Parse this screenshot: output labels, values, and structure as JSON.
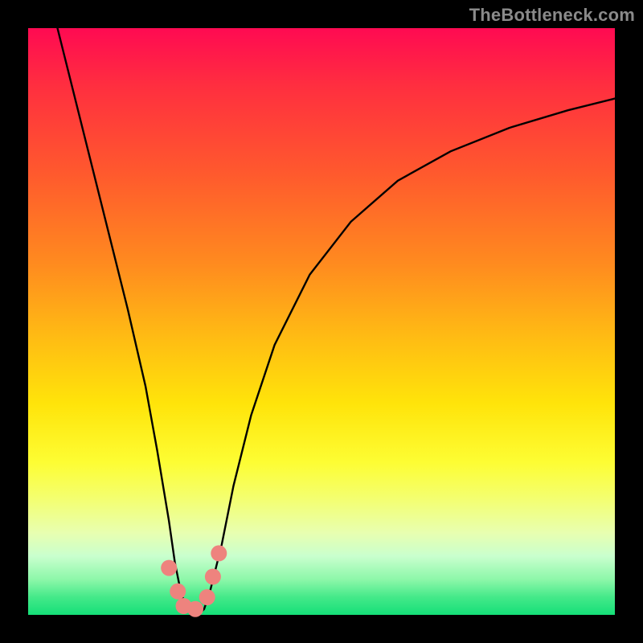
{
  "watermark": "TheBottleneck.com",
  "chart_data": {
    "type": "line",
    "title": "",
    "xlabel": "",
    "ylabel": "",
    "xlim": [
      0,
      100
    ],
    "ylim": [
      0,
      100
    ],
    "series": [
      {
        "name": "curve",
        "x": [
          5,
          8,
          11,
          14,
          17,
          20,
          22,
          24,
          25,
          26,
          27,
          28,
          29,
          30,
          31,
          33,
          35,
          38,
          42,
          48,
          55,
          63,
          72,
          82,
          92,
          100
        ],
        "y": [
          100,
          88,
          76,
          64,
          52,
          39,
          28,
          16,
          9,
          4,
          1,
          0,
          0,
          1,
          4,
          12,
          22,
          34,
          46,
          58,
          67,
          74,
          79,
          83,
          86,
          88
        ]
      }
    ],
    "markers": [
      {
        "x": 24.0,
        "y": 8.0
      },
      {
        "x": 25.5,
        "y": 4.0
      },
      {
        "x": 26.5,
        "y": 1.5
      },
      {
        "x": 28.5,
        "y": 1.0
      },
      {
        "x": 30.5,
        "y": 3.0
      },
      {
        "x": 31.5,
        "y": 6.5
      },
      {
        "x": 32.5,
        "y": 10.5
      }
    ],
    "colors": {
      "curve": "#000000",
      "marker": "#ee837e"
    },
    "gradient_stops": [
      {
        "pos": 0,
        "color": "#ff0a52"
      },
      {
        "pos": 25,
        "color": "#ff5a2d"
      },
      {
        "pos": 52,
        "color": "#ffb914"
      },
      {
        "pos": 74,
        "color": "#fdfd33"
      },
      {
        "pos": 90,
        "color": "#c9ffce"
      },
      {
        "pos": 100,
        "color": "#15df78"
      }
    ]
  }
}
